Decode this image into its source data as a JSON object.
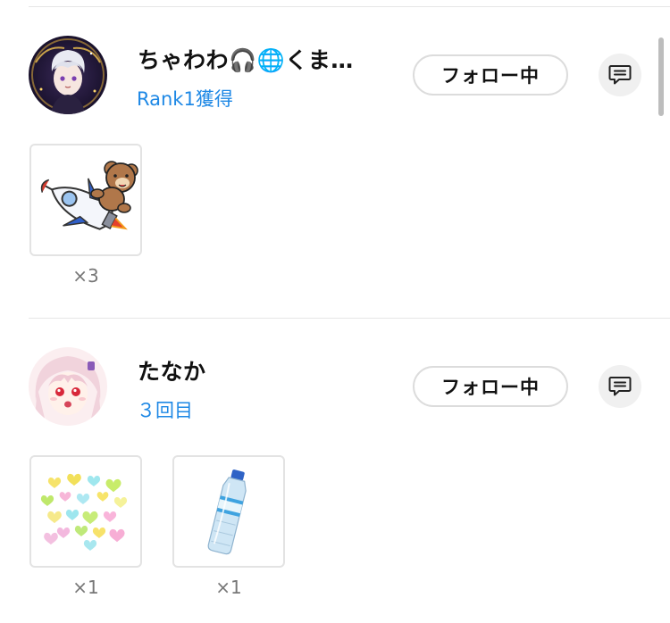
{
  "entries": [
    {
      "name_text": "ちゃわわ",
      "name_emoji_1": "🎧",
      "name_emoji_2": "🌐",
      "name_suffix": "くま…",
      "subtitle": "Rank1獲得",
      "follow_label": "フォロー中",
      "gifts": [
        {
          "icon": "teddy-bear-rocket",
          "count": "×3"
        }
      ]
    },
    {
      "name_text": "たなか",
      "subtitle": "３回目",
      "follow_label": "フォロー中",
      "gifts": [
        {
          "icon": "hearts",
          "count": "×1"
        },
        {
          "icon": "water-bottle",
          "count": "×1"
        }
      ]
    }
  ],
  "colors": {
    "accent_blue": "#1e88e5",
    "divider": "#e6e6e6",
    "button_border": "#dcdcdc",
    "message_button_bg": "#f0f0f0"
  },
  "icons": {
    "message": "message-icon"
  }
}
